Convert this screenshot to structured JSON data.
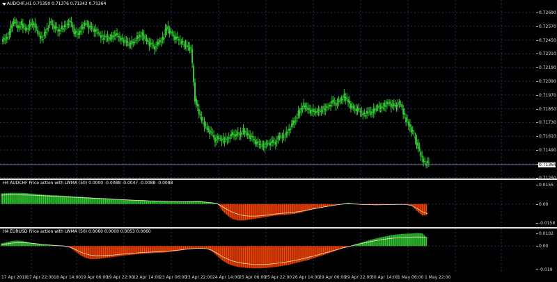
{
  "main_chart": {
    "label": "AUDCHF,H1  0.71350 0.71376 0.71342 0.71364",
    "price_box": "0.71364",
    "scale_ticks": [
      "0.72690",
      "0.72570",
      "0.72450",
      "0.72310",
      "0.72190",
      "0.72090",
      "0.71970",
      "0.71850",
      "0.71730",
      "0.71610",
      "0.71490",
      "0.71370",
      "0.71250"
    ],
    "candle_color": "#32cd32",
    "closes": [
      0.7247,
      0.7253,
      0.7265,
      0.7257,
      0.7261,
      0.7256,
      0.7259,
      0.7262,
      0.7252,
      0.7247,
      0.7255,
      0.7262,
      0.7259,
      0.7254,
      0.7257,
      0.726,
      0.7263,
      0.7254,
      0.7251,
      0.7258,
      0.7262,
      0.7257,
      0.7256,
      0.7252,
      0.7248,
      0.725,
      0.7247,
      0.7252,
      0.7249,
      0.7246,
      0.7245,
      0.7242,
      0.7246,
      0.7249,
      0.7251,
      0.7246,
      0.7242,
      0.724,
      0.7244,
      0.7247,
      0.7259,
      0.7252,
      0.7249,
      0.7246,
      0.7243,
      0.7241,
      0.7238,
      0.7193,
      0.7179,
      0.7172,
      0.7166,
      0.7162,
      0.7156,
      0.7157,
      0.7155,
      0.7157,
      0.716,
      0.7161,
      0.716,
      0.7164,
      0.7161,
      0.7158,
      0.7154,
      0.7151,
      0.715,
      0.7153,
      0.7153,
      0.7154,
      0.7159,
      0.7158,
      0.7164,
      0.7169,
      0.7175,
      0.7182,
      0.7187,
      0.7184,
      0.7181,
      0.7182,
      0.7181,
      0.7184,
      0.7186,
      0.719,
      0.7189,
      0.7191,
      0.7195,
      0.7191,
      0.7184,
      0.7184,
      0.7181,
      0.7178,
      0.7182,
      0.718,
      0.7186,
      0.7184,
      0.7187,
      0.719,
      0.7186,
      0.7188,
      0.7188,
      0.7176,
      0.717,
      0.7162,
      0.7153,
      0.7141,
      0.7134,
      0.7136
    ],
    "grid_color": "#23316b",
    "axis_min": 0.7125,
    "axis_max": 0.7275
  },
  "pane2": {
    "label": "H4 AUDCHF Price action with LWMA (50) 0.0000 -0.0088 -0.0047 -0.0088 -0.0088",
    "scale_ticks": [
      "0.0155",
      "0.00",
      "-0.0158"
    ],
    "values": [
      0.0082,
      0.0085,
      0.0087,
      0.0086,
      0.0086,
      0.0083,
      0.008,
      0.0076,
      0.0072,
      0.007,
      0.0068,
      0.0066,
      0.0063,
      0.0061,
      0.0058,
      0.0056,
      0.0053,
      0.005,
      0.0048,
      0.0046,
      0.0044,
      0.0041,
      0.0038,
      0.0035,
      0.0033,
      0.0031,
      0.0029,
      0.0027,
      0.0025,
      0.0024,
      0.0022,
      0.002,
      0.0019,
      0.0018,
      0.0018,
      0.002,
      0.0022,
      0.0024,
      0.0023,
      0.0016,
      0.0012,
      0.0006,
      -0.0052,
      -0.009,
      -0.0118,
      -0.0128,
      -0.0128,
      -0.0122,
      -0.0116,
      -0.011,
      -0.0103,
      -0.0096,
      -0.009,
      -0.0086,
      -0.0084,
      -0.008,
      -0.0075,
      -0.0066,
      -0.0054,
      -0.0044,
      -0.0036,
      -0.0028,
      -0.002,
      -0.0011,
      -0.0005,
      0.0004,
      0.001,
      0.0002,
      -0.0004,
      -0.0006,
      -0.0007,
      -0.0008,
      -0.0007,
      -0.0006,
      -0.0004,
      -0.0002,
      0.0,
      -0.0003,
      -0.0012,
      -0.0056,
      -0.0088,
      -0.0088
    ],
    "lwma": [
      0.007,
      0.0071,
      0.0072,
      0.0072,
      0.0071,
      0.007,
      0.0068,
      0.0066,
      0.0064,
      0.0062,
      0.006,
      0.0058,
      0.0056,
      0.0054,
      0.0052,
      0.005,
      0.0048,
      0.0046,
      0.0044,
      0.0042,
      0.004,
      0.0038,
      0.0036,
      0.0034,
      0.0032,
      0.003,
      0.0028,
      0.0027,
      0.0025,
      0.0024,
      0.0022,
      0.0021,
      0.002,
      0.0019,
      0.0018,
      0.0018,
      0.0018,
      0.0018,
      0.0017,
      0.0014,
      0.001,
      0.0004,
      -0.002,
      -0.0045,
      -0.0065,
      -0.008,
      -0.009,
      -0.0094,
      -0.0094,
      -0.0092,
      -0.0088,
      -0.0083,
      -0.0078,
      -0.0074,
      -0.007,
      -0.0066,
      -0.0062,
      -0.0056,
      -0.0048,
      -0.004,
      -0.0032,
      -0.0025,
      -0.0018,
      -0.0011,
      -0.0005,
      0.0,
      0.0002,
      0.0,
      -0.0002,
      -0.0004,
      -0.0005,
      -0.0006,
      -0.0006,
      -0.0005,
      -0.0004,
      -0.0003,
      -0.0002,
      -0.0004,
      -0.0012,
      -0.0035,
      -0.006,
      -0.0075
    ],
    "ymin": -0.0158,
    "ymax": 0.0155
  },
  "pane3": {
    "label": "H4 EURUSD Price action with LWMA (50) 0.0060 0.0000 0.0053 0.0060",
    "scale_ticks": [
      "0.0102",
      "0.00",
      "-0.019"
    ],
    "values": [
      0.002,
      0.003,
      0.0038,
      0.0042,
      0.0038,
      0.003,
      0.0022,
      0.0016,
      0.0012,
      0.0008,
      0.0005,
      0.0003,
      0.0002,
      -0.001,
      -0.004,
      -0.007,
      -0.009,
      -0.01,
      -0.01,
      -0.0096,
      -0.009,
      -0.0085,
      -0.008,
      -0.0074,
      -0.007,
      -0.0066,
      -0.0062,
      -0.0058,
      -0.0056,
      -0.0054,
      -0.0052,
      -0.005,
      -0.0045,
      -0.004,
      -0.0034,
      -0.0028,
      -0.0022,
      -0.0018,
      -0.0018,
      -0.002,
      -0.004,
      -0.0075,
      -0.011,
      -0.0135,
      -0.015,
      -0.016,
      -0.0165,
      -0.0168,
      -0.017,
      -0.017,
      -0.0168,
      -0.0165,
      -0.016,
      -0.0155,
      -0.0148,
      -0.014,
      -0.013,
      -0.012,
      -0.011,
      -0.0098,
      -0.0085,
      -0.0072,
      -0.0058,
      -0.0044,
      -0.003,
      -0.0016,
      -0.0003,
      0.001,
      0.0022,
      0.0034,
      0.0046,
      0.0056,
      0.0066,
      0.0074,
      0.0082,
      0.0088,
      0.0092,
      0.0094,
      0.0096,
      0.01,
      0.0097,
      0.006
    ],
    "lwma": [
      0.001,
      0.0016,
      0.0022,
      0.0026,
      0.0026,
      0.0024,
      0.002,
      0.0016,
      0.0012,
      0.0008,
      0.0005,
      0.0002,
      0.0,
      -0.0008,
      -0.0025,
      -0.0045,
      -0.006,
      -0.007,
      -0.0074,
      -0.0074,
      -0.0072,
      -0.007,
      -0.0066,
      -0.0062,
      -0.0058,
      -0.0055,
      -0.0052,
      -0.0049,
      -0.0047,
      -0.0045,
      -0.0043,
      -0.0041,
      -0.0038,
      -0.0034,
      -0.003,
      -0.0025,
      -0.0021,
      -0.0018,
      -0.0018,
      -0.002,
      -0.0032,
      -0.0055,
      -0.008,
      -0.01,
      -0.0115,
      -0.0125,
      -0.0132,
      -0.0137,
      -0.014,
      -0.0141,
      -0.014,
      -0.0138,
      -0.0134,
      -0.0129,
      -0.0123,
      -0.0116,
      -0.0108,
      -0.0099,
      -0.009,
      -0.008,
      -0.0069,
      -0.0058,
      -0.0047,
      -0.0036,
      -0.0025,
      -0.0014,
      -0.0004,
      0.0006,
      0.0015,
      0.0024,
      0.0032,
      0.004,
      0.0047,
      0.0053,
      0.0058,
      0.0062,
      0.0065,
      0.0067,
      0.0068,
      0.0069,
      0.0068,
      0.006
    ],
    "ymin": -0.019,
    "ymax": 0.0102
  },
  "indicator_colors": {
    "positive": "#32cd32",
    "negative": "#ff4500",
    "lwma": "#f0e6c8"
  },
  "time_axis": [
    "17 Apr 2019",
    "17 Apr 22:00",
    "18 Apr 14:00",
    "19 Apr 06:00",
    "19 Apr 22:00",
    "22 Apr 14:00",
    "23 Apr 06:00",
    "23 Apr 22:00",
    "24 Apr 14:00",
    "25 Apr 06:00",
    "25 Apr 22:00",
    "26 Apr 14:00",
    "29 Apr 06:00",
    "29 Apr 22:00",
    "30 Apr 14:00",
    "1 May 06:00",
    "1 May 22:00"
  ]
}
